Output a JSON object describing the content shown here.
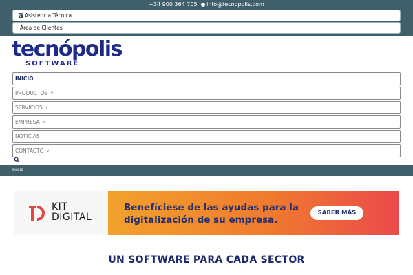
{
  "topbar": {
    "phone": "+34 900 364 705",
    "email": "info@tecnopolis.com",
    "support_label": "Asistencia Técnica",
    "clients_label": "Área de Clientes"
  },
  "logo": {
    "name": "tecnópolis",
    "subtitle": "SOFTWARE",
    "brand_color": "#1d2a8a"
  },
  "nav": {
    "items": [
      {
        "label": "INICIO",
        "active": true,
        "has_dropdown": false
      },
      {
        "label": "PRODUCTOS",
        "has_dropdown": true
      },
      {
        "label": "SERVICIOS",
        "has_dropdown": true
      },
      {
        "label": "EMPRESA",
        "has_dropdown": true
      },
      {
        "label": "NOTICIAS",
        "has_dropdown": false
      },
      {
        "label": "CONTACTO",
        "has_dropdown": true
      }
    ],
    "search_icon": "search-icon",
    "dropdown_icon": "chevron-down-icon"
  },
  "breadcrumb": {
    "current": "Inicio"
  },
  "banner": {
    "logo_text_line1": "KIT",
    "logo_text_line2": "DIGITAL",
    "headline_line1": "Benefíciese de las ayudas para la",
    "headline_line2": "digitalización de su empresa.",
    "cta": "SABER MÁS",
    "gradient": [
      "#f2a22c",
      "#ea4a4a"
    ]
  },
  "section": {
    "title": "UN SOFTWARE PARA CADA SECTOR"
  },
  "colors": {
    "bar": "#3f5f6a",
    "navy": "#1d2a6a"
  }
}
